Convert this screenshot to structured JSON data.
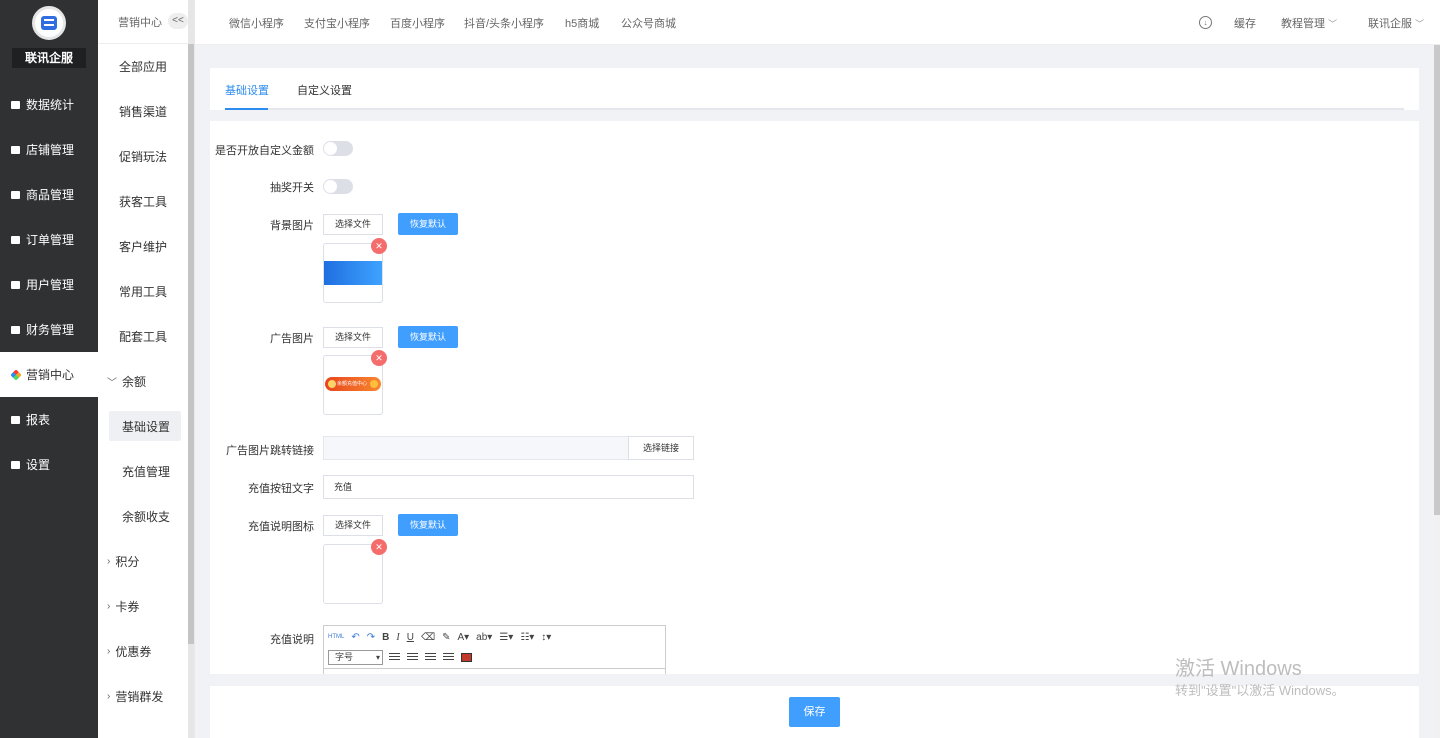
{
  "sidebar": {
    "brand": "联讯企服",
    "items": [
      {
        "label": "数据统计",
        "icon": "chart-icon"
      },
      {
        "label": "店铺管理",
        "icon": "store-icon"
      },
      {
        "label": "商品管理",
        "icon": "goods-icon"
      },
      {
        "label": "订单管理",
        "icon": "order-icon"
      },
      {
        "label": "用户管理",
        "icon": "user-icon"
      },
      {
        "label": "财务管理",
        "icon": "finance-icon"
      },
      {
        "label": "营销中心",
        "icon": "marketing-icon",
        "active": true
      },
      {
        "label": "报表",
        "icon": "report-icon"
      },
      {
        "label": "设置",
        "icon": "settings-icon"
      }
    ]
  },
  "submenu": {
    "title": "营销中心",
    "collapse": "<<",
    "items": [
      "全部应用",
      "销售渠道",
      "促销玩法",
      "获客工具",
      "客户维护",
      "常用工具",
      "配套工具"
    ],
    "group_open": "余额",
    "group_children": [
      "基础设置",
      "充值管理",
      "余额收支"
    ],
    "groups_closed": [
      "积分",
      "卡券",
      "优惠券",
      "营销群发"
    ]
  },
  "topbar": {
    "tabs": [
      "微信小程序",
      "支付宝小程序",
      "百度小程序",
      "抖音/头条小程序",
      "h5商城",
      "公众号商城"
    ],
    "cache": "缓存",
    "tutorial": "教程管理",
    "account": "联讯企服"
  },
  "card_tabs": {
    "basic": "基础设置",
    "custom": "自定义设置"
  },
  "form": {
    "custom_amount_label": "是否开放自定义金额",
    "lottery_label": "抽奖开关",
    "bg_label": "背景图片",
    "ad_label": "广告图片",
    "ad_link_label": "广告图片跳转链接",
    "ad_link_button": "选择链接",
    "btn_text_label": "充值按钮文字",
    "btn_text_value": "充值",
    "icon_label": "充值说明图标",
    "desc_label": "充值说明",
    "choose_file": "选择文件",
    "restore_default": "恢复默认",
    "ad_image_text": "余额充值中心",
    "editor_font": "字号"
  },
  "save_label": "保存",
  "watermark": {
    "line1": "激活 Windows",
    "line2": "转到\"设置\"以激活 Windows。"
  }
}
